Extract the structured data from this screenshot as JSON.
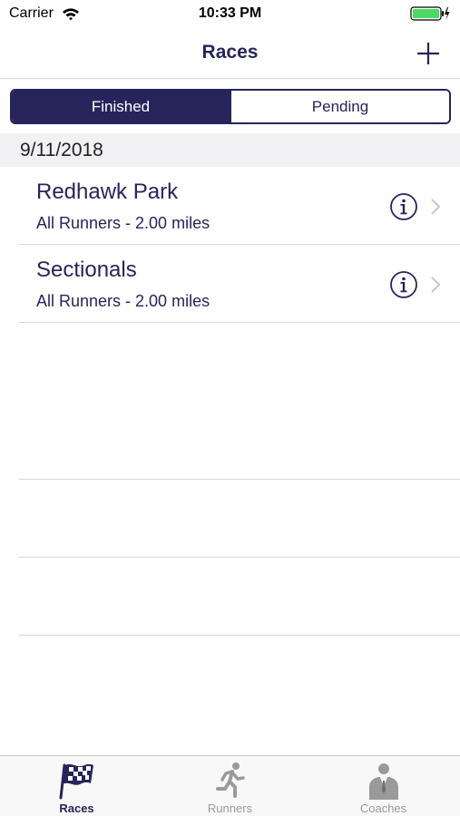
{
  "status_bar": {
    "carrier": "Carrier",
    "time": "10:33 PM"
  },
  "nav": {
    "title": "Races",
    "add_icon": "plus-icon"
  },
  "segments": {
    "finished": "Finished",
    "pending": "Pending",
    "selected": "Finished"
  },
  "section": {
    "date": "9/11/2018"
  },
  "races": [
    {
      "name": "Redhawk Park",
      "detail": "All Runners - 2.00 miles"
    },
    {
      "name": "Sectionals",
      "detail": "All Runners - 2.00 miles"
    }
  ],
  "tabs": [
    {
      "label": "Races",
      "icon": "checkered-flag-icon",
      "active": true
    },
    {
      "label": "Runners",
      "icon": "runner-icon",
      "active": false
    },
    {
      "label": "Coaches",
      "icon": "coach-icon",
      "active": false
    }
  ],
  "colors": {
    "accent": "#27245c",
    "battery": "#4cd964",
    "inactive_tab": "#9a9a9a"
  }
}
